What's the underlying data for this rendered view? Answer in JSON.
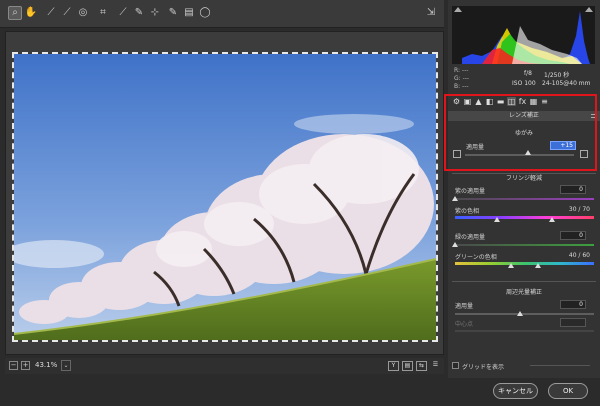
{
  "toolbar": {
    "tools": [
      {
        "icon": "zoom-icon",
        "glyph": "⌕",
        "active": true
      },
      {
        "icon": "hand-icon",
        "glyph": "✋"
      },
      {
        "icon": "white-balance-icon",
        "glyph": "⟋"
      },
      {
        "icon": "color-sampler-icon",
        "glyph": "⟋"
      },
      {
        "icon": "target-adjust-icon",
        "glyph": "◎"
      },
      {
        "icon": "crop-icon",
        "glyph": "⌗"
      },
      {
        "icon": "straighten-icon",
        "glyph": "⟋"
      },
      {
        "icon": "spot-removal-icon",
        "glyph": "✎"
      },
      {
        "icon": "red-eye-icon",
        "glyph": "⊹"
      },
      {
        "icon": "adjustment-brush-icon",
        "glyph": "✎"
      },
      {
        "icon": "graduated-filter-icon",
        "glyph": "▤"
      },
      {
        "icon": "radial-filter-icon",
        "glyph": "◯"
      }
    ],
    "export_icon": "⇲"
  },
  "status": {
    "zoom_out": "−",
    "zoom_in": "+",
    "zoom_level": "43.1%",
    "zoom_dropdown": "⌄",
    "view_icons": [
      "Y",
      "▤",
      "⇆",
      "☰"
    ]
  },
  "info": {
    "r": "R:  ---",
    "g": "G:  ---",
    "b": "B:  ---",
    "aperture": "f/8",
    "shutter": "1/250 秒",
    "iso": "ISO 100",
    "lens": "24-105@40 mm"
  },
  "tabs": [
    "⚙",
    "▣",
    "▲",
    "◧",
    "▬",
    "◫",
    "fx",
    "▦",
    "≡"
  ],
  "lens_correction": {
    "title": "レンズ補正",
    "distortion": {
      "heading": "ゆがみ",
      "amount_label": "適用量",
      "amount_value": "+15",
      "amount_fraction": 0.575
    },
    "fringe": {
      "heading": "フリンジ軽減",
      "purple_amount_label": "紫の適用量",
      "purple_amount_value": "0",
      "purple_hue_label": "紫の色相",
      "purple_hue_value": "30 / 70",
      "purple_hue_range": [
        30,
        70
      ],
      "green_amount_label": "緑の適用量",
      "green_amount_value": "0",
      "green_hue_label": "グリーンの色相",
      "green_hue_value": "40 / 60",
      "green_hue_range": [
        40,
        60
      ]
    },
    "vignette": {
      "heading": "周辺光量補正",
      "amount_label": "適用量",
      "amount_value": "0",
      "midpoint_label": "中心点",
      "midpoint_value": ""
    }
  },
  "grid_label": "グリッドを表示",
  "buttons": {
    "cancel": "キャンセル",
    "ok": "OK"
  }
}
